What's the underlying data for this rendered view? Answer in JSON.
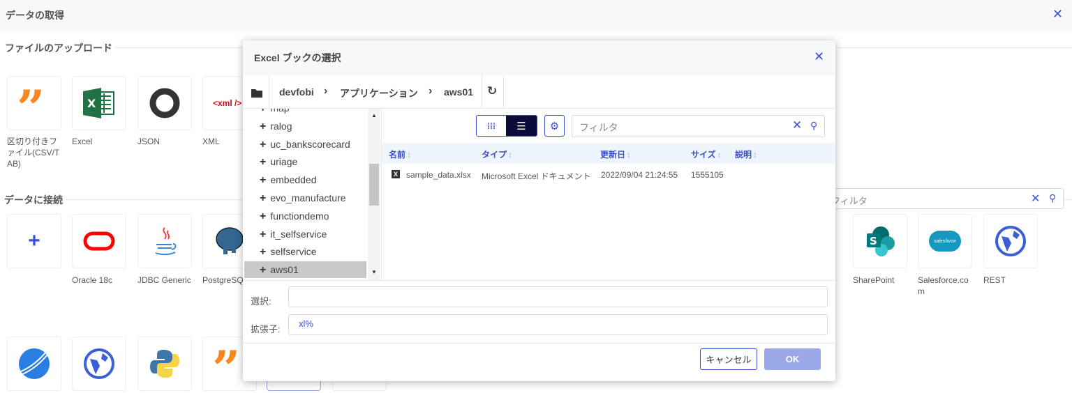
{
  "header": {
    "title": "データの取得",
    "close_icon": "close-icon"
  },
  "upload": {
    "title": "ファイルのアップロード",
    "tiles": [
      {
        "label": "区切り付きファイル(CSV/TAB)",
        "icon": "quote-icon"
      },
      {
        "label": "Excel",
        "icon": "excel-icon"
      },
      {
        "label": "JSON",
        "icon": "json-icon"
      },
      {
        "label": "XML",
        "icon": "xml-icon",
        "icon_text": "<xml />"
      }
    ]
  },
  "connect": {
    "title": "データに接続",
    "filter_placeholder": "フィルタ",
    "tiles": [
      {
        "label": "",
        "icon": "plus-icon"
      },
      {
        "label": "Oracle 18c",
        "icon": "oracle-icon"
      },
      {
        "label": "JDBC Generic",
        "icon": "java-icon"
      },
      {
        "label": "PostgreSQL",
        "icon": "postgresql-icon"
      },
      {
        "label": "SharePoint",
        "icon": "sharepoint-icon"
      },
      {
        "label": "Salesforce.com",
        "icon": "salesforce-icon",
        "icon_text": "salesforce"
      },
      {
        "label": "REST",
        "icon": "globe-icon"
      }
    ],
    "row3_icons": [
      "tibco-icon",
      "globe-icon",
      "python-icon",
      "quote-icon"
    ]
  },
  "dialog": {
    "title": "Excel ブックの選択",
    "breadcrumb": [
      "devfobi",
      "アプリケーション",
      "aws01"
    ],
    "tree": [
      "map",
      "ralog",
      "uc_bankscorecard",
      "uriage",
      "embedded",
      "evo_manufacture",
      "functiondemo",
      "it_selfservice",
      "selfservice",
      "aws01"
    ],
    "tree_selected": "aws01",
    "filter_placeholder": "フィルタ",
    "view_mode": "list",
    "columns": [
      "名前",
      "タイプ",
      "更新日",
      "サイズ",
      "説明"
    ],
    "rows": [
      {
        "name": "sample_data.xlsx",
        "type": "Microsoft Excel ドキュメント",
        "date": "2022/09/04 21:24:55",
        "size": "1555105",
        "desc": ""
      }
    ],
    "select_label": "選択:",
    "select_value": "",
    "ext_label": "拡張子:",
    "ext_value": "xl%",
    "cancel": "キャンセル",
    "ok": "OK"
  },
  "colors": {
    "accent": "#3b4fd8",
    "dark": "#0b0b3b",
    "ok_disabled": "#9aa8ea"
  }
}
